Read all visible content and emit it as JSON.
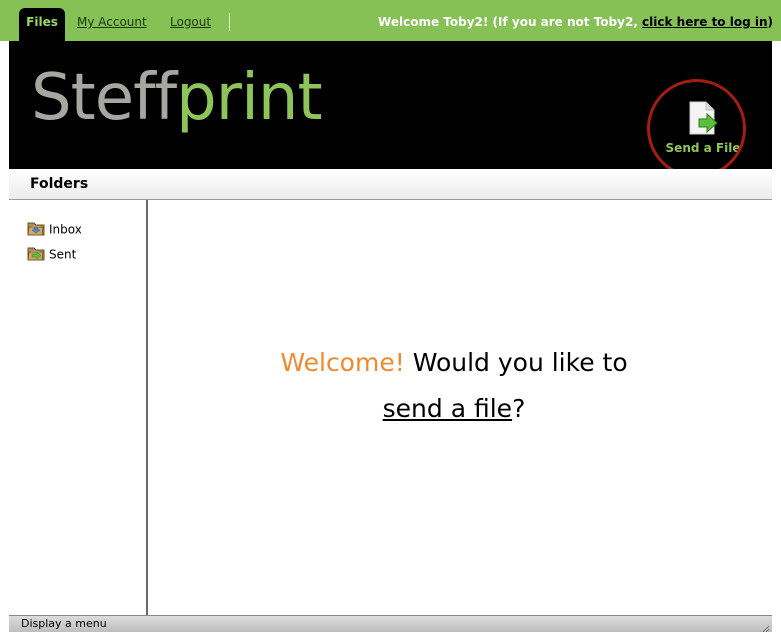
{
  "topnav": {
    "tabs": [
      {
        "label": "Files",
        "active": true
      },
      {
        "label": "My Account",
        "active": false
      },
      {
        "label": "Logout",
        "active": false
      }
    ],
    "welcome_text": "Welcome Toby2! (If you are not Toby2, ",
    "login_link": "click here to log in",
    "welcome_close": ")"
  },
  "header": {
    "logo_part1": "Steff",
    "logo_part2": "print",
    "send_button_label": "Send a File",
    "send_button_icon": "send-file-icon"
  },
  "folders": {
    "title": "Folders",
    "items": [
      {
        "label": "Inbox",
        "icon": "inbox-folder-icon"
      },
      {
        "label": "Sent",
        "icon": "sent-folder-icon"
      }
    ]
  },
  "main": {
    "welcome_highlight": "Welcome!",
    "welcome_rest": " Would you like to",
    "send_link": "send a file",
    "send_suffix": "?"
  },
  "statusbar": {
    "text": "Display a menu"
  },
  "colors": {
    "accent_green": "#85c155",
    "logo_green": "#8ec45a",
    "welcome_orange": "#ef8a2e",
    "annotation_red": "#a41d14"
  }
}
